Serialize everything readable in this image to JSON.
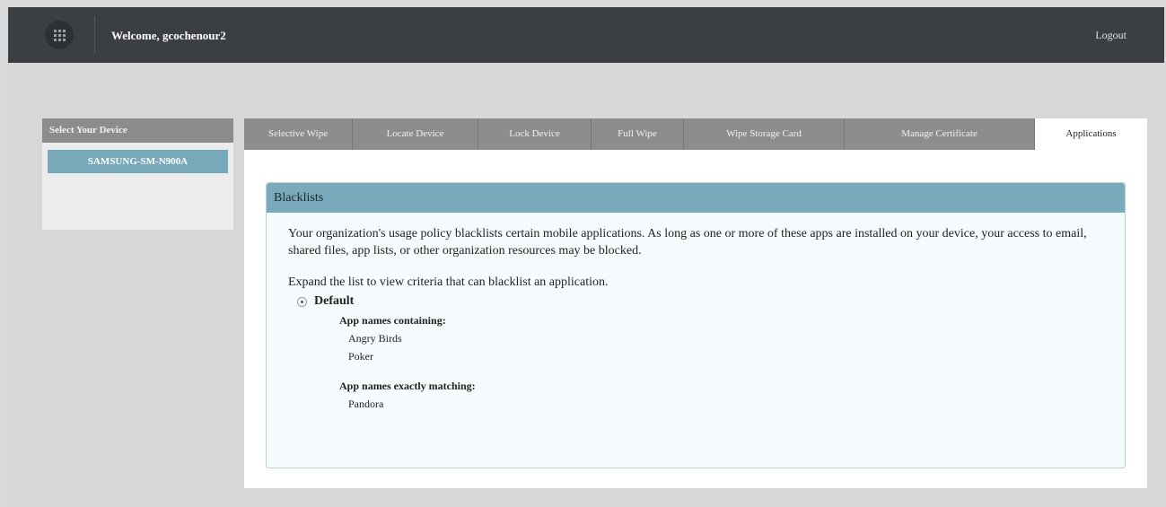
{
  "header": {
    "welcome_text": "Welcome, gcochenour2",
    "logout_label": "Logout"
  },
  "sidebar": {
    "title": "Select Your Device",
    "devices": [
      {
        "label": "SAMSUNG-SM-N900A"
      }
    ]
  },
  "tabs": [
    {
      "label": "Selective Wipe",
      "active": false
    },
    {
      "label": "Locate Device",
      "active": false
    },
    {
      "label": "Lock Device",
      "active": false
    },
    {
      "label": "Full Wipe",
      "active": false
    },
    {
      "label": "Wipe Storage Card",
      "active": false
    },
    {
      "label": "Manage Certificate",
      "active": false
    },
    {
      "label": "Applications",
      "active": true
    }
  ],
  "blacklists": {
    "title": "Blacklists",
    "policy_text": "Your organization's usage policy blacklists certain mobile applications. As long as one or more of these apps are installed on your device, your access to email, shared files, app lists, or other organization resources may be blocked.",
    "expand_text": "Expand the list to view criteria that can blacklist an application.",
    "group_name": "Default",
    "containing_label": "App names containing:",
    "containing_values": [
      "Angry Birds",
      "Poker"
    ],
    "matching_label": "App names exactly matching:",
    "matching_values": [
      "Pandora"
    ]
  },
  "colors": {
    "header_bg": "#3b3f43",
    "accent": "#79a9ba",
    "tab_bg": "#8d8d8d"
  },
  "icons": {
    "logo": "grid-logo-icon",
    "expand": "radio-expand-icon"
  }
}
